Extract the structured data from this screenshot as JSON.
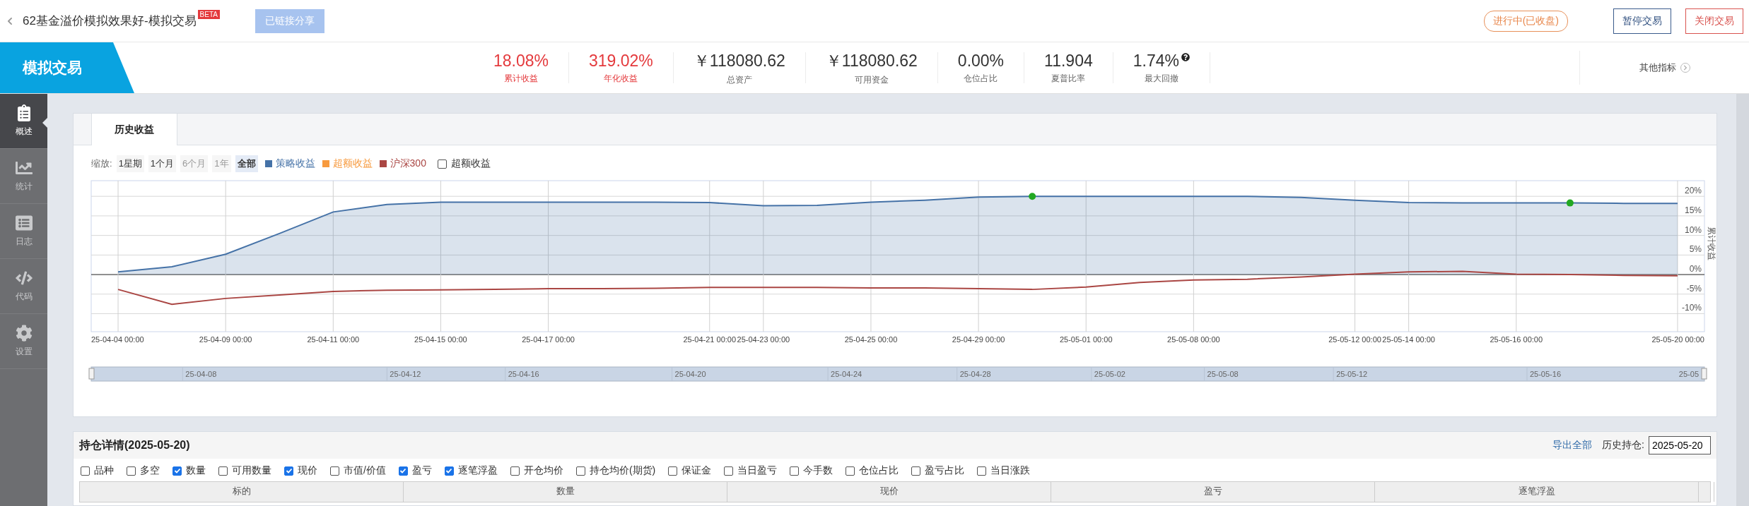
{
  "header": {
    "title": "62基金溢价模拟效果好-模拟交易",
    "badge": "BETA",
    "share_button": "已链接分享",
    "status": "进行中(已收盘)",
    "buttons": [
      {
        "label": "暂停交易",
        "kind": "pause"
      },
      {
        "label": "关闭交易",
        "kind": "close"
      }
    ]
  },
  "banner": {
    "title": "模拟交易"
  },
  "stats": [
    {
      "value": "18.08%",
      "label": "累计收益",
      "color": "#e4393c"
    },
    {
      "value": "319.02%",
      "label": "年化收益",
      "color": "#e4393c"
    },
    {
      "value": "￥118080.62",
      "label": "总资产",
      "color": "#333333"
    },
    {
      "value": "￥118080.62",
      "label": "可用资金",
      "color": "#333333"
    },
    {
      "value": "0.00%",
      "label": "仓位占比",
      "color": "#333333"
    },
    {
      "value": "11.904",
      "label": "夏普比率",
      "color": "#333333"
    },
    {
      "value": "1.74%",
      "label": "最大回撤",
      "color": "#333333",
      "help": true
    }
  ],
  "other_metrics": "其他指标",
  "sidebar": {
    "items": [
      {
        "label": "概述",
        "kind": "overview",
        "selected": true
      },
      {
        "label": "统计",
        "kind": "stats",
        "selected": false
      },
      {
        "label": "日志",
        "kind": "log",
        "selected": false
      },
      {
        "label": "代码",
        "kind": "code",
        "selected": false
      },
      {
        "label": "设置",
        "kind": "settings",
        "selected": false
      }
    ]
  },
  "history": {
    "tabs": [
      {
        "label": "历史收益",
        "selected": true
      }
    ],
    "zoom_label": "缩放:",
    "zoom_buttons": [
      {
        "label": "1星期",
        "selected": false,
        "disabled": false
      },
      {
        "label": "1个月",
        "selected": false,
        "disabled": false
      },
      {
        "label": "6个月",
        "selected": false,
        "disabled": true
      },
      {
        "label": "1年",
        "selected": false,
        "disabled": true
      },
      {
        "label": "全部",
        "selected": true,
        "disabled": false
      }
    ],
    "toggle": {
      "label": "超额收益",
      "checked": false
    },
    "chart_data": {
      "type": "area",
      "ylabel": "累计收益",
      "ylim": [
        -14.6,
        24
      ],
      "grid": true,
      "categories": [
        "25-04-04 00:00",
        null,
        "25-04-09 00:00",
        null,
        "25-04-11 00:00",
        null,
        "25-04-15 00:00",
        null,
        "25-04-17 00:00",
        null,
        null,
        "25-04-21 00:00",
        "25-04-23 00:00",
        null,
        "25-04-25 00:00",
        null,
        "25-04-29 00:00",
        null,
        "25-05-01 00:00",
        null,
        "25-05-08 00:00",
        null,
        null,
        "25-05-12 00:00",
        "25-05-14 00:00",
        null,
        "25-05-16 00:00",
        null,
        null,
        "25-05-20 00:00"
      ],
      "yticks": [
        {
          "value": 20,
          "label": "20%"
        },
        {
          "value": 15,
          "label": "15%"
        },
        {
          "value": 10,
          "label": "10%"
        },
        {
          "value": 5,
          "label": "5%"
        },
        {
          "value": 0,
          "label": "0%"
        },
        {
          "value": -5,
          "label": "-5%"
        },
        {
          "value": -10,
          "label": "-10%"
        }
      ],
      "series": [
        {
          "name": "策略收益",
          "color": "#4572a7",
          "values": [
            0.7,
            2.0,
            5.2,
            10.5,
            16.0,
            17.9,
            18.5,
            18.5,
            18.5,
            18.5,
            18.5,
            18.4,
            17.6,
            17.7,
            18.5,
            19.0,
            19.8,
            20,
            20,
            20,
            20,
            20,
            19.7,
            19.0,
            18.4,
            18.3,
            18.3,
            18.3,
            18.2,
            18.2
          ]
        },
        {
          "name": "超额收益",
          "color": "#f79a3e",
          "values": [
            null,
            null,
            null,
            null,
            null,
            null,
            null,
            null,
            null,
            null,
            null,
            null,
            null,
            null,
            null,
            null,
            null,
            null,
            null,
            null,
            null,
            null,
            null,
            null,
            null,
            null,
            null,
            null,
            null,
            null
          ]
        },
        {
          "name": "沪深300",
          "color": "#aa4643",
          "type": "line",
          "values": [
            -3.8,
            -7.6,
            -6.1,
            -5.2,
            -4.3,
            -4.0,
            -3.9,
            -3.8,
            -3.6,
            -3.6,
            -3.5,
            -3.3,
            -3.3,
            -3.3,
            -3.4,
            -3.4,
            -3.6,
            -3.8,
            -3.2,
            -2.0,
            -1.4,
            -1.2,
            -0.6,
            0.1,
            0.7,
            0.8,
            0.1,
            0.0,
            -0.2,
            -0.3
          ]
        }
      ]
    },
    "navigator": {
      "labels": [
        "25-04-08",
        "25-04-12",
        "25-04-16",
        "25-04-20",
        "25-04-24",
        "25-04-28",
        "25-05-02",
        "25-05-08",
        "25-05-12",
        "25-05-16",
        "25-05"
      ]
    }
  },
  "holdings": {
    "title": "持仓详情(2025-05-20)",
    "export": "导出全部",
    "history_label": "历史持仓:",
    "date": "2025-05-20",
    "options": [
      {
        "label": "品种",
        "checked": false
      },
      {
        "label": "多空",
        "checked": false
      },
      {
        "label": "数量",
        "checked": true
      },
      {
        "label": "可用数量",
        "checked": false
      },
      {
        "label": "现价",
        "checked": true
      },
      {
        "label": "市值/价值",
        "checked": false
      },
      {
        "label": "盈亏",
        "checked": true
      },
      {
        "label": "逐笔浮盈",
        "checked": true
      },
      {
        "label": "开仓均价",
        "checked": false
      },
      {
        "label": "持仓均价(期货)",
        "checked": false
      },
      {
        "label": "保证金",
        "checked": false
      },
      {
        "label": "当日盈亏",
        "checked": false
      },
      {
        "label": "今手数",
        "checked": false
      },
      {
        "label": "仓位占比",
        "checked": false
      },
      {
        "label": "盈亏占比",
        "checked": false
      },
      {
        "label": "当日涨跌",
        "checked": false
      }
    ],
    "table": {
      "columns": [
        "标的",
        "数量",
        "现价",
        "盈亏",
        "逐笔浮盈"
      ]
    }
  }
}
